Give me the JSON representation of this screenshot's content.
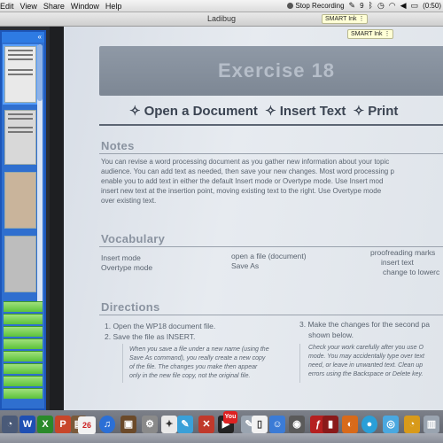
{
  "menubar": {
    "menus": [
      "Edit",
      "View",
      "Share",
      "Window",
      "Help"
    ],
    "recording_label": "Stop Recording",
    "status_count": "9",
    "battery": "(0:50)"
  },
  "window": {
    "title": "Ladibug"
  },
  "smart_ink": {
    "tag_label": "SMART Ink"
  },
  "document": {
    "banner": "Exercise 18",
    "subtitle": [
      "Open a Document",
      "Insert Text",
      "Print"
    ],
    "notes_heading": "Notes",
    "notes_lines": [
      "You can revise a word processing document as you gather new information about your topic",
      "audience. You can add text as needed, then save your new changes. Most word processing p",
      "enable you to add text in either the default Insert mode or Overtype mode. Use Insert mod",
      "insert new text at the insertion point, moving existing text to the right. Use Overtype mode",
      "over existing text."
    ],
    "vocabulary_heading": "Vocabulary",
    "vocab_col1": [
      "Insert mode",
      "Overtype mode"
    ],
    "vocab_col2": [
      "open a file (document)",
      "Save As"
    ],
    "vocab_col3": [
      "proofreading marks",
      "insert text",
      "change to lowerc"
    ],
    "directions_heading": "Directions",
    "directions_left": [
      "1. Open the WP18 document file.",
      "2. Save the file as INSERT."
    ],
    "directions_note": [
      "When you save a file under a new name (using the",
      "Save As command), you really create a new copy",
      "of the file. The changes you make then appear",
      "only in the new file copy, not the original file."
    ],
    "directions_right": [
      "3. Make the changes for the second pa",
      "shown below."
    ],
    "directions_right_note": [
      "Check your work carefully after you use O",
      "mode. You may accidentally type over text",
      "need, or leave in unwanted text. Clean up",
      "errors using the Backspace or Delete key."
    ]
  },
  "dock": {
    "calendar_day": "26",
    "icons": [
      "dashboard-icon",
      "word-icon",
      "excel-icon",
      "powerpoint-icon",
      "app-icon",
      "calendar-icon",
      "itunes-icon",
      "photo-icon",
      "system-prefs-icon",
      "app-store-icon",
      "script-icon",
      "tools-icon",
      "video-icon",
      "youtube-icon",
      "text-icon",
      "document-icon",
      "finder-icon",
      "camera-icon",
      "flash-icon",
      "media-icon",
      "app-icon-2",
      "record-icon",
      "preview-icon",
      "app-icon-3",
      "trash-icon"
    ]
  }
}
